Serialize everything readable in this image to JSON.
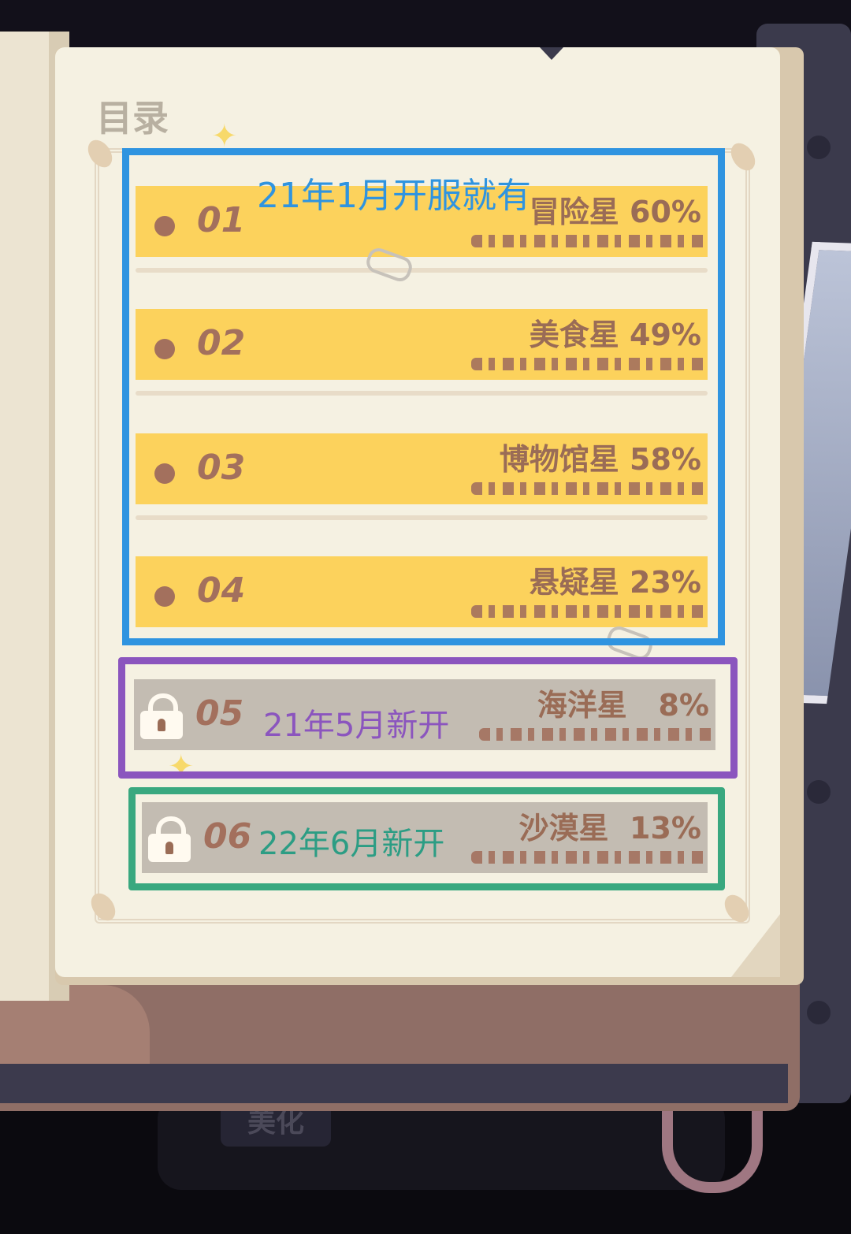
{
  "book": {
    "title": "目录",
    "chapters": [
      {
        "number": "01",
        "name": "冒险星",
        "progress": "60%",
        "locked": false
      },
      {
        "number": "02",
        "name": "美食星",
        "progress": "49%",
        "locked": false
      },
      {
        "number": "03",
        "name": "博物馆星",
        "progress": "58%",
        "locked": false
      },
      {
        "number": "04",
        "name": "悬疑星",
        "progress": "23%",
        "locked": false
      },
      {
        "number": "05",
        "name": "海洋星",
        "progress": "8%",
        "locked": true
      },
      {
        "number": "06",
        "name": "沙漠星",
        "progress": "13%",
        "locked": true
      }
    ]
  },
  "annotations": {
    "blue_note": "21年1月开服就有",
    "purple_note": "21年5月新开",
    "green_note": "22年6月新开"
  },
  "bottom_bar": {
    "tab_label": "美化"
  },
  "colors": {
    "unlocked_band": "#fcd25c",
    "locked_band": "#c3bcb2",
    "blue_box": "#2f94e0",
    "purple_box": "#8b55be",
    "green_box": "#39a87f",
    "text_brown": "#9a6c56"
  },
  "icons": {
    "lock": "lock-icon",
    "bullet": "bullet-dot-icon",
    "sparkle": "sparkle-icon",
    "paperclip": "paperclip-icon"
  }
}
